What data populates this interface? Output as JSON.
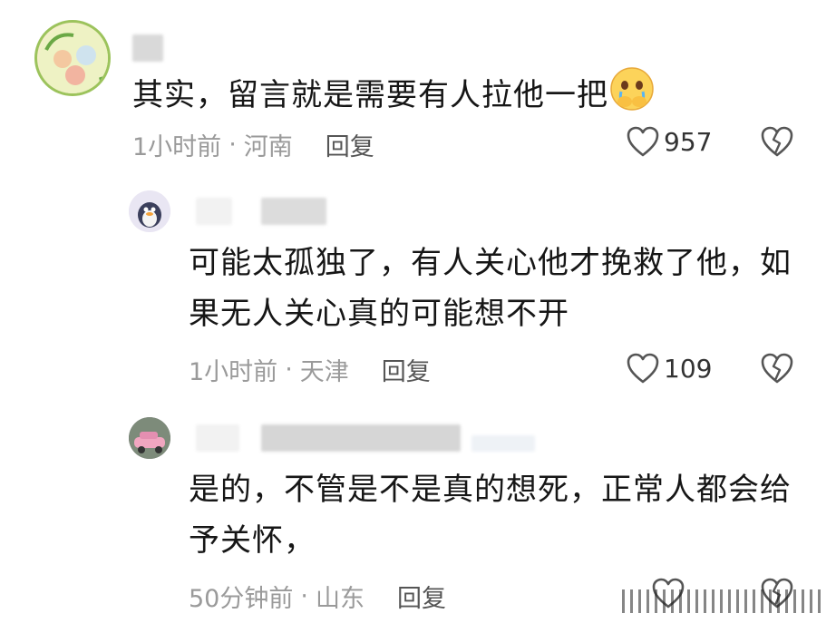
{
  "comments": [
    {
      "text": "其实，留言就是需要有人拉他一把",
      "time": "1小时前",
      "location": "河南",
      "reply": "回复",
      "likes": "957",
      "emoji": "crying-face-hands-over-mouth"
    },
    {
      "text_line1": "可能太孤独了，有人关心他才挽救了他，如",
      "text_line2": "果无人关心真的可能想不开",
      "time": "1小时前",
      "location": "天津",
      "reply": "回复",
      "likes": "109"
    },
    {
      "text_line1": "是的，不管是不是真的想死，正常人都会给",
      "text_line2": "予关怀，",
      "time": "50分钟前",
      "location": "山东",
      "reply": "回复"
    }
  ],
  "separator": "·",
  "colors": {
    "meta": "#9a9a9a",
    "text": "#161616",
    "icon": "#555555"
  }
}
